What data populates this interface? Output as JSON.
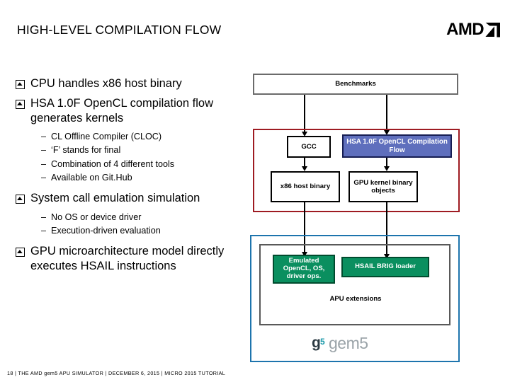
{
  "slide": {
    "title": "HIGH-LEVEL COMPILATION FLOW",
    "logo": {
      "text": "AMD",
      "icon": "amd-arrow-icon"
    },
    "footer": "18  |  THE AMD gem5 APU SIMULATOR   |   DECEMBER 6, 2015   |   MICRO 2015 TUTORIAL"
  },
  "bullets": [
    {
      "text": "CPU handles x86 host binary",
      "sub": []
    },
    {
      "text": "HSA 1.0F OpenCL compilation flow generates kernels",
      "sub": [
        "CL Offline Compiler (CLOC)",
        "‘F’ stands for final",
        "Combination of 4 different tools",
        "Available on Git.Hub"
      ]
    },
    {
      "text": "System call emulation simulation",
      "sub": [
        "No OS or device driver",
        "Execution-driven evaluation"
      ]
    },
    {
      "text": "GPU microarchitecture model directly executes HSAIL instructions",
      "sub": []
    }
  ],
  "diagram": {
    "benchmarks": "Benchmarks",
    "gcc": "GCC",
    "hsa_flow": "HSA 1.0F OpenCL Compilation Flow",
    "x86_host": "x86 host binary",
    "gpu_kernel": "GPU kernel binary objects",
    "emulated": "Emulated OpenCL, OS, driver ops.",
    "hsail_loader": "HSAIL BRIG loader",
    "apu_extensions": "APU extensions",
    "gem5_logo_mark": "g",
    "gem5_logo_sup": "5",
    "gem5_logo_word": "gem5",
    "colors": {
      "red_group_border": "#9e1b22",
      "blue_group_border": "#1d74ad",
      "gray_group_border": "#595959",
      "blue_box_fill": "#5f6fbd",
      "green_box_fill": "#0a8f5f",
      "gem5_teal": "#1b9aaa"
    }
  }
}
